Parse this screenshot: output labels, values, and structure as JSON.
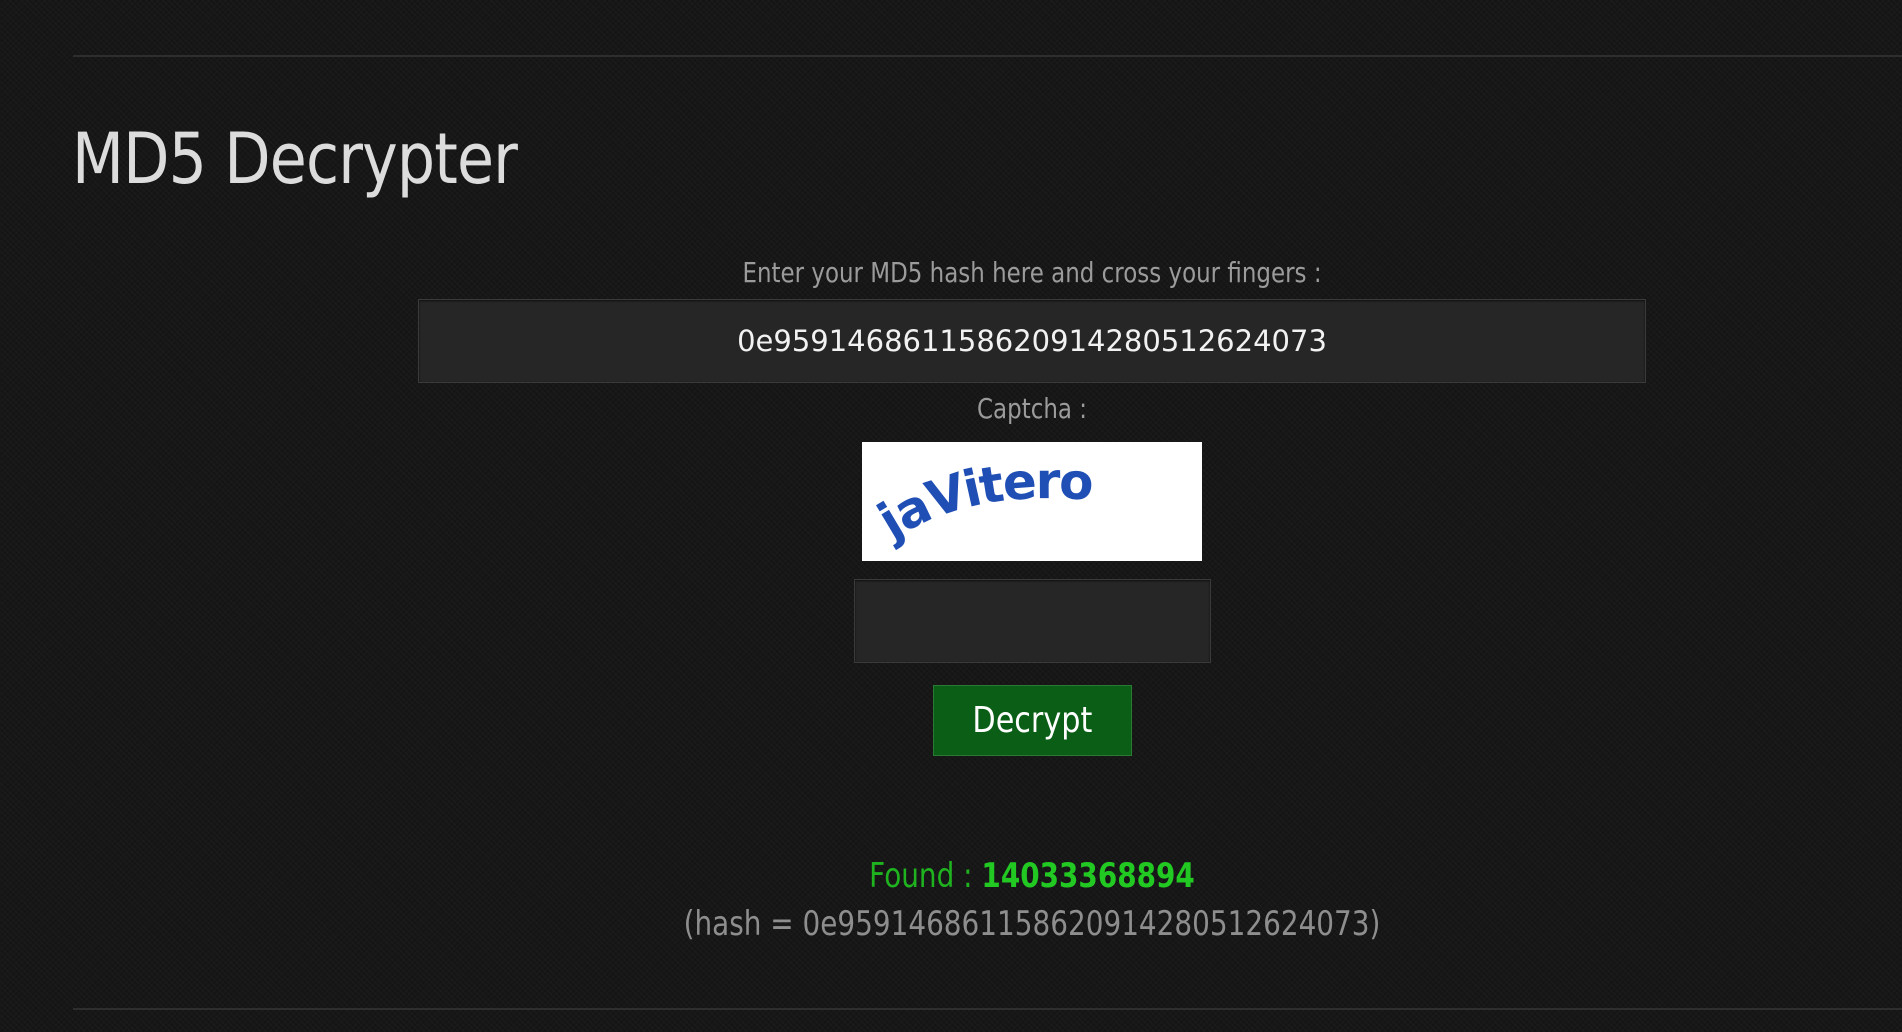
{
  "page": {
    "title": "MD5 Decrypter"
  },
  "form": {
    "hash_label": "Enter your MD5 hash here and cross your fingers :",
    "hash_value": "0e959146861158620914280512624073",
    "captcha_label": "Captcha :",
    "captcha_text": "jaVitero",
    "captcha_input_value": "",
    "decrypt_label": "Decrypt"
  },
  "result": {
    "found_label": "Found : ",
    "found_value": "14033368894",
    "hash_echo": "(hash = 0e959146861158620914280512624073)"
  },
  "colors": {
    "background": "#171717",
    "button": "#0b5e16",
    "found": "#22c922",
    "captcha_ink": "#1f4fb5"
  }
}
